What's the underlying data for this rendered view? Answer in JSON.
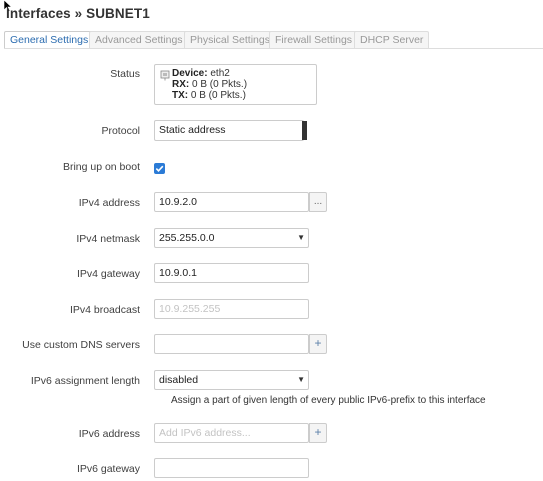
{
  "page": {
    "title": "Interfaces » SUBNET1"
  },
  "tabs": [
    {
      "label": "General Settings",
      "active": true
    },
    {
      "label": "Advanced Settings"
    },
    {
      "label": "Physical Settings"
    },
    {
      "label": "Firewall Settings"
    },
    {
      "label": "DHCP Server"
    }
  ],
  "status": {
    "label": "Status",
    "device_key": "Device:",
    "device_value": "eth2",
    "rx_key": "RX:",
    "rx_value": "0 B (0 Pkts.)",
    "tx_key": "TX:",
    "tx_value": "0 B (0 Pkts.)"
  },
  "protocol": {
    "label": "Protocol",
    "value": "Static address"
  },
  "boot": {
    "label": "Bring up on boot",
    "checked": true
  },
  "ipv4_address": {
    "label": "IPv4 address",
    "value": "10.9.2.0",
    "button": "..."
  },
  "ipv4_netmask": {
    "label": "IPv4 netmask",
    "value": "255.255.0.0"
  },
  "ipv4_gateway": {
    "label": "IPv4 gateway",
    "value": "10.9.0.1"
  },
  "ipv4_broadcast": {
    "label": "IPv4 broadcast",
    "placeholder": "10.9.255.255"
  },
  "dns": {
    "label": "Use custom DNS servers",
    "value": "",
    "button": "+"
  },
  "ipv6_assign": {
    "label": "IPv6 assignment length",
    "value": "disabled",
    "help": "Assign a part of given length of every public IPv6-prefix to this interface"
  },
  "ipv6_address": {
    "label": "IPv6 address",
    "placeholder": "Add IPv6 address...",
    "button": "+"
  },
  "ipv6_gateway": {
    "label": "IPv6 gateway",
    "value": ""
  },
  "colors": {
    "accent": "#2b7bd6",
    "tab_active_text": "#2b6cb0"
  }
}
